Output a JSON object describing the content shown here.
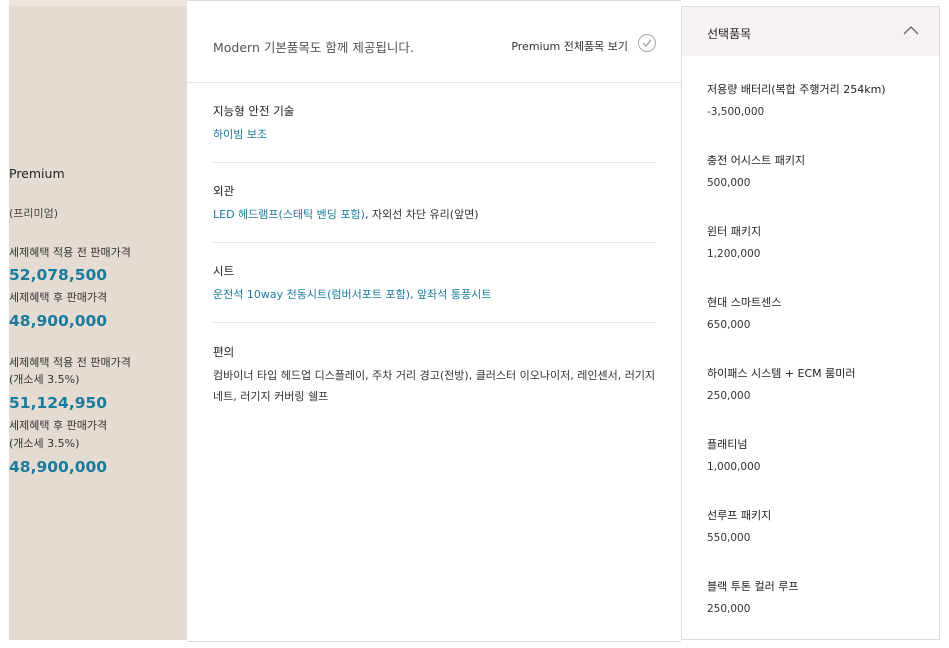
{
  "left": {
    "trim_name": "Premium",
    "trim_sub": "(프리미엄)",
    "prices": [
      {
        "label": "세제혜택 적용 전 판매가격",
        "value": "52,078,500"
      },
      {
        "label": "세제혜택 후 판매가격",
        "value": "48,900,000"
      },
      {
        "label": "세제혜택 적용 전 판매가격",
        "note": "(개소세 3.5%)",
        "value": "51,124,950"
      },
      {
        "label": "세제혜택 후 판매가격",
        "note": "(개소세 3.5%)",
        "value": "48,900,000"
      }
    ]
  },
  "center": {
    "head_text": "Modern 기본품목도 함께 제공됩니다.",
    "head_link": "Premium 전체품목 보기",
    "sections": [
      {
        "title": "지능형 안전 기술",
        "highlight": "하이빔 보조",
        "rest": ""
      },
      {
        "title": "외관",
        "highlight": "LED 헤드램프(스태틱 벤딩 포함)",
        "rest": ", 자외선 차단 유리(앞면)"
      },
      {
        "title": "시트",
        "highlight": "운전석 10way 전동시트(럼버서포트 포함), 앞좌석 통풍시트",
        "rest": ""
      },
      {
        "title": "편의",
        "highlight": "",
        "rest": "컴바이너 타입 헤드업 디스플레이, 주차 거리 경고(전방), 클러스터 이오나이저, 레인센서, 러기지 네트, 러기지 커버링 쉘프"
      }
    ]
  },
  "right": {
    "title": "선택품목",
    "options": [
      {
        "name": "저용량 배터리(복합 주행거리 254km)",
        "price": "-3,500,000"
      },
      {
        "name": "충전 어시스트 패키지",
        "price": "500,000"
      },
      {
        "name": "윈터 패키지",
        "price": "1,200,000"
      },
      {
        "name": "현대 스마트센스",
        "price": "650,000"
      },
      {
        "name": "하이패스 시스템 + ECM 룸미러",
        "price": "250,000"
      },
      {
        "name": "플래티넘",
        "price": "1,000,000"
      },
      {
        "name": "선루프 패키지",
        "price": "550,000"
      },
      {
        "name": "블랙 투톤 컬러 루프",
        "price": "250,000"
      }
    ]
  },
  "icons": {
    "check": "check-circle-icon",
    "chevron": "chevron-up-icon"
  },
  "colors": {
    "accent": "#1b7b9c",
    "left_bg": "#e4dcd3"
  }
}
